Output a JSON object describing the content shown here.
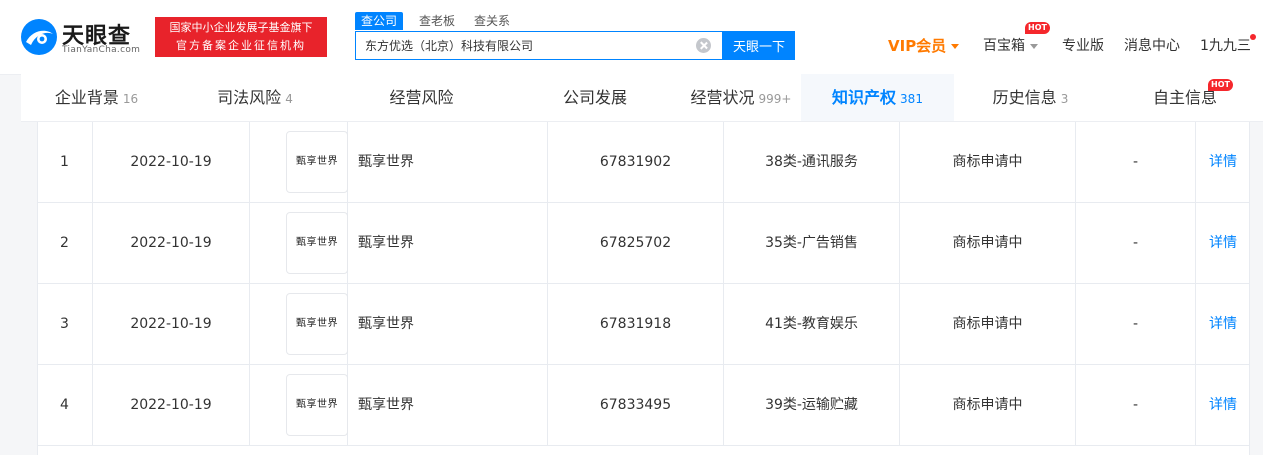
{
  "brand": {
    "name_cn": "天眼查",
    "name_en": "TianYanCha.com",
    "badge_line1": "国家中小企业发展子基金旗下",
    "badge_line2": "官方备案企业征信机构",
    "color": "#0084ff"
  },
  "search": {
    "tabs": [
      "查公司",
      "查老板",
      "查关系"
    ],
    "active_tab": "查公司",
    "value": "东方优选（北京）科技有限公司",
    "button": "天眼一下"
  },
  "topnav": {
    "vip": "VIP会员",
    "treasure": "百宝箱",
    "hot": "HOT",
    "pro": "专业版",
    "messages": "消息中心",
    "user": "1九九三"
  },
  "tabs": [
    {
      "label": "企业背景",
      "count": "16"
    },
    {
      "label": "司法风险",
      "count": "4"
    },
    {
      "label": "经营风险",
      "count": ""
    },
    {
      "label": "公司发展",
      "count": ""
    },
    {
      "label": "经营状况",
      "count": "999+"
    },
    {
      "label": "知识产权",
      "count": "381",
      "active": true
    },
    {
      "label": "历史信息",
      "count": "3"
    },
    {
      "label": "自主信息",
      "count": "",
      "hot": "HOT"
    }
  ],
  "trademarks": {
    "detail_label": "详情",
    "rows": [
      {
        "no": "1",
        "date": "2022-10-19",
        "image_text": "甄享世界",
        "name": "甄享世界",
        "reg_no": "67831902",
        "class": "38类-通讯服务",
        "status": "商标申请中",
        "extra": "-"
      },
      {
        "no": "2",
        "date": "2022-10-19",
        "image_text": "甄享世界",
        "name": "甄享世界",
        "reg_no": "67825702",
        "class": "35类-广告销售",
        "status": "商标申请中",
        "extra": "-"
      },
      {
        "no": "3",
        "date": "2022-10-19",
        "image_text": "甄享世界",
        "name": "甄享世界",
        "reg_no": "67831918",
        "class": "41类-教育娱乐",
        "status": "商标申请中",
        "extra": "-"
      },
      {
        "no": "4",
        "date": "2022-10-19",
        "image_text": "甄享世界",
        "name": "甄享世界",
        "reg_no": "67833495",
        "class": "39类-运输贮藏",
        "status": "商标申请中",
        "extra": "-"
      }
    ]
  }
}
